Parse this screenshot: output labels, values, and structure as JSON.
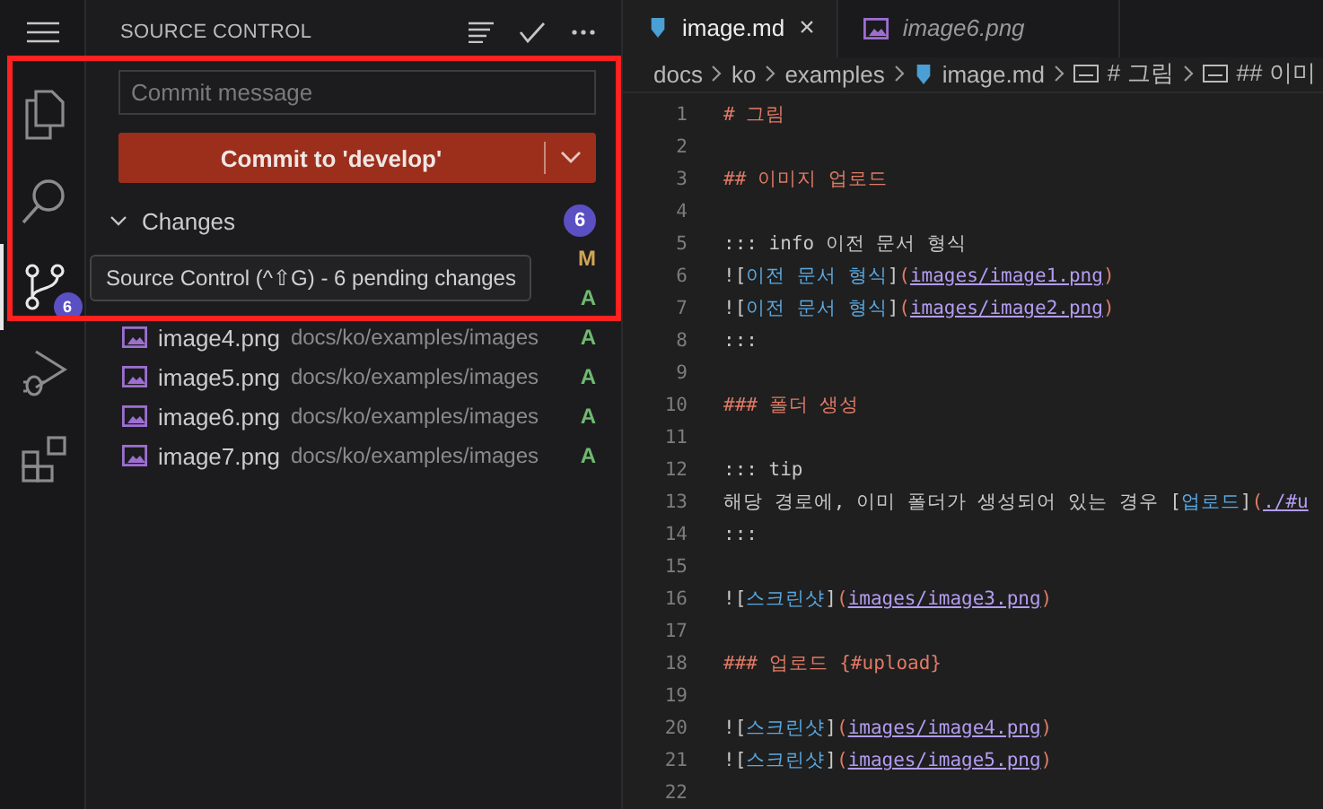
{
  "activity_bar": {
    "items": [
      {
        "kind": "explorer",
        "selected": false
      },
      {
        "kind": "search",
        "selected": false
      },
      {
        "kind": "source-control",
        "selected": true,
        "badge": "6"
      },
      {
        "kind": "debug",
        "selected": false
      },
      {
        "kind": "extensions",
        "selected": false
      }
    ]
  },
  "sidebar": {
    "title": "SOURCE CONTROL",
    "commit_message": {
      "placeholder": "Commit message"
    },
    "commit_button": "Commit to 'develop'",
    "changes": {
      "label": "Changes",
      "expanded": true,
      "count": "6",
      "files": [
        {
          "status": "M"
        },
        {
          "status": "A"
        },
        {
          "kind": "image",
          "name": "image4.png",
          "path": "docs/ko/examples/images",
          "status": "A"
        },
        {
          "kind": "image",
          "name": "image5.png",
          "path": "docs/ko/examples/images",
          "status": "A"
        },
        {
          "kind": "image",
          "name": "image6.png",
          "path": "docs/ko/examples/images",
          "status": "A"
        },
        {
          "kind": "image",
          "name": "image7.png",
          "path": "docs/ko/examples/images",
          "status": "A"
        }
      ]
    }
  },
  "tooltip": "Source Control (^⇧G) - 6 pending changes",
  "tabs": [
    {
      "kind": "markdown",
      "label": "image.md",
      "selected": true,
      "preview": false,
      "close": "×"
    },
    {
      "kind": "image",
      "label": "image6.png",
      "selected": false,
      "preview": true
    }
  ],
  "breadcrumb": [
    {
      "kind": "folder",
      "label": "docs"
    },
    {
      "kind": "folder",
      "label": "ko"
    },
    {
      "kind": "folder",
      "label": "examples"
    },
    {
      "kind": "markdown",
      "label": "image.md"
    },
    {
      "kind": "symbol",
      "label": "# 그림"
    },
    {
      "kind": "symbol",
      "label": "## 이미"
    }
  ],
  "lines": [
    {
      "n": "1",
      "tokens": [
        {
          "kind": "heading",
          "text": "# 그림"
        }
      ]
    },
    {
      "n": "2"
    },
    {
      "n": "3",
      "tokens": [
        {
          "kind": "heading",
          "text": "## 이미지 업로드"
        }
      ]
    },
    {
      "n": "4"
    },
    {
      "n": "5",
      "tokens": [
        {
          "kind": "plain",
          "text": "::: info 이전 문서 형식"
        }
      ]
    },
    {
      "n": "6",
      "tokens": [
        {
          "kind": "plain",
          "text": "!["
        },
        {
          "kind": "label",
          "text": "이전 문서 형식"
        },
        {
          "kind": "plain",
          "text": "]"
        },
        {
          "kind": "paren",
          "text": "("
        },
        {
          "kind": "url",
          "text": "images/image1.png"
        },
        {
          "kind": "paren",
          "text": ")"
        }
      ]
    },
    {
      "n": "7",
      "tokens": [
        {
          "kind": "plain",
          "text": "!["
        },
        {
          "kind": "label",
          "text": "이전 문서 형식"
        },
        {
          "kind": "plain",
          "text": "]"
        },
        {
          "kind": "paren",
          "text": "("
        },
        {
          "kind": "url",
          "text": "images/image2.png"
        },
        {
          "kind": "paren",
          "text": ")"
        }
      ]
    },
    {
      "n": "8",
      "tokens": [
        {
          "kind": "plain",
          "text": ":::"
        }
      ]
    },
    {
      "n": "9"
    },
    {
      "n": "10",
      "tokens": [
        {
          "kind": "heading",
          "text": "### 폴더 생성"
        }
      ]
    },
    {
      "n": "11"
    },
    {
      "n": "12",
      "tokens": [
        {
          "kind": "plain",
          "text": "::: tip"
        }
      ]
    },
    {
      "n": "13",
      "tokens": [
        {
          "kind": "plain",
          "text": "해당 경로에, 이미 폴더가 생성되어 있는 경우 ["
        },
        {
          "kind": "label",
          "text": "업로드"
        },
        {
          "kind": "plain",
          "text": "]"
        },
        {
          "kind": "paren",
          "text": "("
        },
        {
          "kind": "url",
          "text": "./#u"
        }
      ]
    },
    {
      "n": "14",
      "tokens": [
        {
          "kind": "plain",
          "text": ":::"
        }
      ]
    },
    {
      "n": "15"
    },
    {
      "n": "16",
      "tokens": [
        {
          "kind": "plain",
          "text": "!["
        },
        {
          "kind": "label",
          "text": "스크린샷"
        },
        {
          "kind": "plain",
          "text": "]"
        },
        {
          "kind": "paren",
          "text": "("
        },
        {
          "kind": "url",
          "text": "images/image3.png"
        },
        {
          "kind": "paren",
          "text": ")"
        }
      ]
    },
    {
      "n": "17"
    },
    {
      "n": "18",
      "tokens": [
        {
          "kind": "heading",
          "text": "### 업로드 {#upload}"
        }
      ]
    },
    {
      "n": "19"
    },
    {
      "n": "20",
      "tokens": [
        {
          "kind": "plain",
          "text": "!["
        },
        {
          "kind": "label",
          "text": "스크린샷"
        },
        {
          "kind": "plain",
          "text": "]"
        },
        {
          "kind": "paren",
          "text": "("
        },
        {
          "kind": "url",
          "text": "images/image4.png"
        },
        {
          "kind": "paren",
          "text": ")"
        }
      ]
    },
    {
      "n": "21",
      "tokens": [
        {
          "kind": "plain",
          "text": "!["
        },
        {
          "kind": "label",
          "text": "스크린샷"
        },
        {
          "kind": "plain",
          "text": "]"
        },
        {
          "kind": "paren",
          "text": "("
        },
        {
          "kind": "url",
          "text": "images/image5.png"
        },
        {
          "kind": "paren",
          "text": ")"
        }
      ]
    },
    {
      "n": "22"
    }
  ]
}
